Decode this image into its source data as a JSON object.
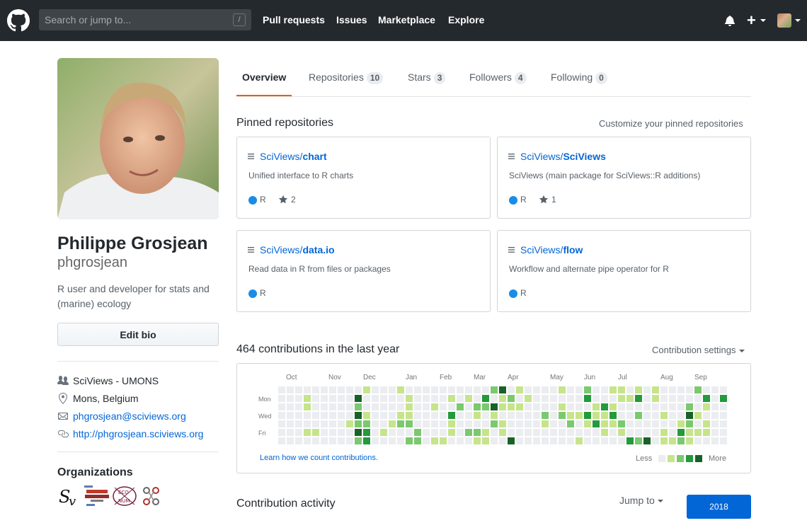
{
  "header": {
    "search_placeholder": "Search or jump to...",
    "slash_key": "/",
    "nav": [
      "Pull requests",
      "Issues",
      "Marketplace",
      "Explore"
    ],
    "plus": "+"
  },
  "profile": {
    "fullname": "Philippe Grosjean",
    "username": "phgrosjean",
    "bio": "R user and developer for stats and (marine) ecology",
    "edit_bio": "Edit bio",
    "company": "SciViews - UMONS",
    "location": "Mons, Belgium",
    "email": "phgrosjean@sciviews.org",
    "website": "http://phgrosjean.sciviews.org",
    "organizations_title": "Organizations"
  },
  "tabs": [
    {
      "label": "Overview",
      "count": ""
    },
    {
      "label": "Repositories",
      "count": "10"
    },
    {
      "label": "Stars",
      "count": "3"
    },
    {
      "label": "Followers",
      "count": "4"
    },
    {
      "label": "Following",
      "count": "0"
    }
  ],
  "pinned": {
    "title": "Pinned repositories",
    "customize": "Customize your pinned repositories",
    "repos": [
      {
        "owner": "SciViews/",
        "name": "chart",
        "desc": "Unified interface to R charts",
        "lang": "R",
        "stars": "2"
      },
      {
        "owner": "SciViews/",
        "name": "SciViews",
        "desc": "SciViews (main package for SciViews::R additions)",
        "lang": "R",
        "stars": "1"
      },
      {
        "owner": "SciViews/",
        "name": "data.io",
        "desc": "Read data in R from files or packages",
        "lang": "R",
        "stars": ""
      },
      {
        "owner": "SciViews/",
        "name": "flow",
        "desc": "Workflow and alternate pipe operator for R",
        "lang": "R",
        "stars": ""
      }
    ]
  },
  "contributions": {
    "title": "464 contributions in the last year",
    "settings": "Contribution settings",
    "months": [
      "Oct",
      "Nov",
      "Dec",
      "Jan",
      "Feb",
      "Mar",
      "Apr",
      "May",
      "Jun",
      "Jul",
      "Aug",
      "Sep"
    ],
    "days": [
      "Mon",
      "Wed",
      "Fri"
    ],
    "learn": "Learn how we count contributions.",
    "less": "Less",
    "more": "More",
    "colors": [
      "#ebedf0",
      "#c6e48b",
      "#7bc96f",
      "#239a3b",
      "#196127"
    ]
  },
  "activity": {
    "title": "Contribution activity",
    "jump_to": "Jump to",
    "year": "2018"
  }
}
